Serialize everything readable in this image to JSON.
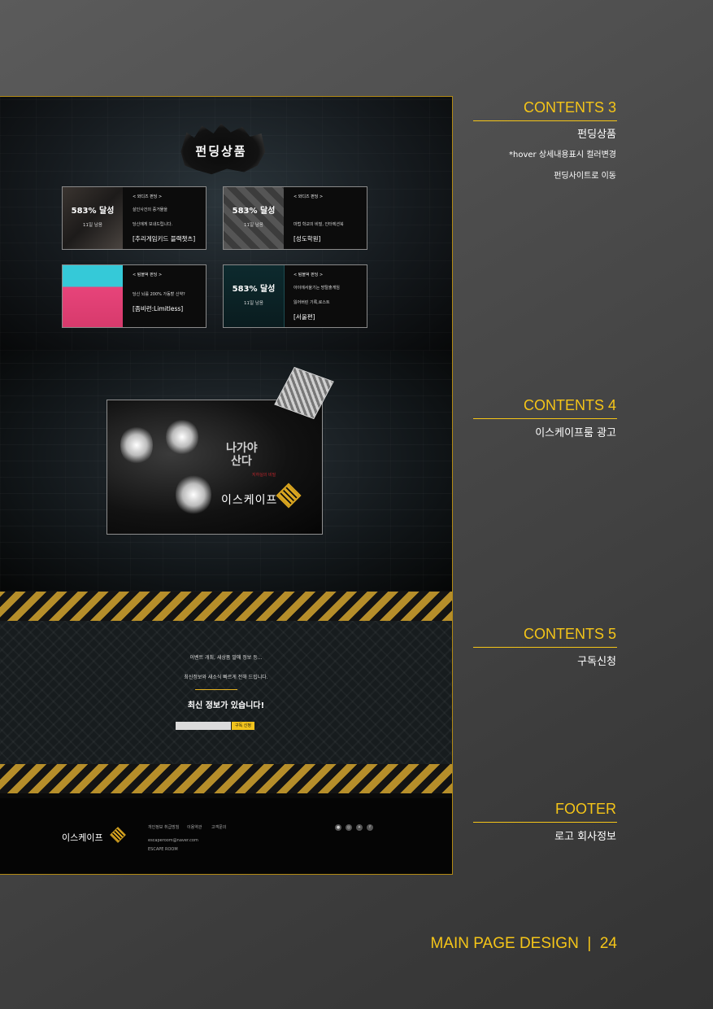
{
  "funding": {
    "title": "펀딩상품",
    "cards": [
      {
        "percent": "583% 달성",
        "days": "11일 남음",
        "category": "< 와디즈 펀딩 >",
        "desc1": "살인사건의 증거물을",
        "desc2": "당신에게 보내드립니다.",
        "name": "[추리게임키드 블랙챗츠]"
      },
      {
        "percent": "583% 달성",
        "days": "11일 남음",
        "category": "< 와디즈 펀딩 >",
        "desc1": "",
        "desc2": "마법 학교의 비밀, 인터렉션북",
        "name": "[성도학원]"
      },
      {
        "percent": "",
        "days": "",
        "category": "< 텀블벅 펀딩 >",
        "desc1": "",
        "desc2": "당신 뇌를 200% 가동할 신약?",
        "name": "[좀비런:Limitless]"
      },
      {
        "percent": "583% 달성",
        "days": "11일 남음",
        "category": "< 텀블벅 펀딩 >",
        "desc1": "아이에서울기는 방탈출게임",
        "desc2": "잃어버린 기록,로스트",
        "name": "[서울편]"
      }
    ]
  },
  "ad": {
    "line1": "나가야",
    "line2": "산다",
    "sub": "지하실의 비밀",
    "brand": "이스케이프"
  },
  "subscribe": {
    "line1": "이벤트 개최, 새상품 발매 정보 등...",
    "line2": "최신정보와 새소식 빠르게 전해 드립니다.",
    "title": "최신 정보가 있습니다!",
    "button": "구독 신청"
  },
  "footer": {
    "logo": "이스케이프",
    "links": [
      "개인정보 취급방침",
      "이용약관",
      "고객문의"
    ],
    "email": "escaperoom@naver.com",
    "company": "ESCAPE ROOM"
  },
  "annotations": [
    {
      "heading": "CONTENTS 3",
      "title": "펀딩상품",
      "notes": [
        "*hover 상세내용표시 컬러변경",
        "펀딩사이트로 이동"
      ]
    },
    {
      "heading": "CONTENTS 4",
      "title": "이스케이프룸 광고",
      "notes": []
    },
    {
      "heading": "CONTENTS 5",
      "title": "구독신청",
      "notes": []
    },
    {
      "heading": "FOOTER",
      "title": "로고 회사정보",
      "notes": []
    }
  ],
  "page_footer": "MAIN PAGE DESIGN  |  24",
  "colors": {
    "accent": "#f5c518",
    "frame": "#b38a14"
  }
}
